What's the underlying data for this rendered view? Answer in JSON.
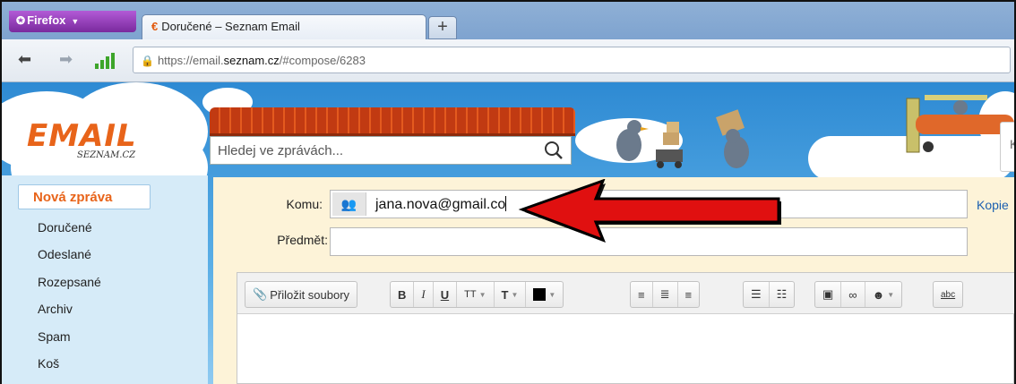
{
  "browser": {
    "menu_label": "Firefox",
    "tab_title": "Doručené – Seznam Email",
    "new_tab": "+",
    "url_scheme": "https://email.",
    "url_host": "seznam.cz",
    "url_path": "/#compose/6283"
  },
  "header": {
    "logo_text": "EMAIL",
    "logo_sub": "SEZNAM.CZ",
    "search_placeholder": "Hledej ve zprávách...",
    "right_partial": "K"
  },
  "sidebar": {
    "new_message": "Nová zpráva",
    "folders": [
      "Doručené",
      "Odeslané",
      "Rozepsané",
      "Archiv",
      "Spam",
      "Koš"
    ]
  },
  "compose": {
    "to_label": "Komu:",
    "to_value": "jana.nova@gmail.co",
    "cc_link": "Kopie",
    "subject_label": "Předmět:",
    "subject_value": "",
    "attach_label": "Přiložit soubory",
    "toolbar": {
      "bold": "B",
      "italic": "I",
      "underline": "U",
      "font_size": "TT",
      "font": "T",
      "spell": "abc"
    }
  },
  "colors": {
    "accent": "#e8641a",
    "sky": "#3b95da",
    "compose_bg": "#fdf3d8",
    "annotation_arrow": "#e01010"
  }
}
